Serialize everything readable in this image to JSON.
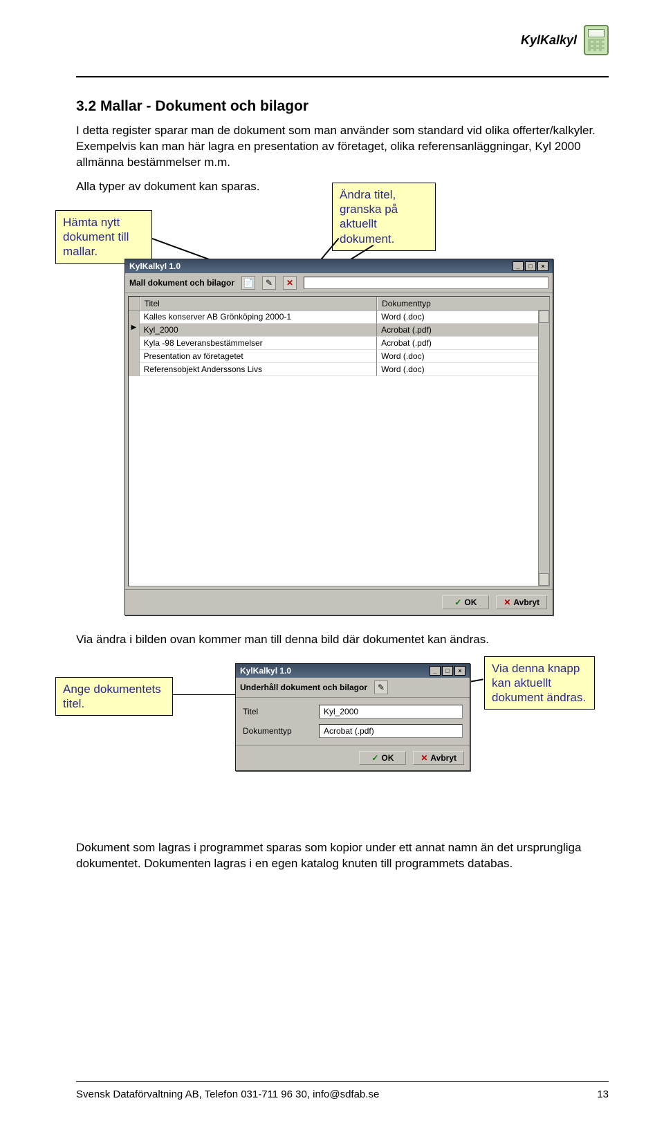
{
  "header": {
    "brand": "KylKalkyl"
  },
  "section_title": "3.2 Mallar - Dokument och bilagor",
  "para1": "I detta register sparar man de dokument som man använder som standard vid olika offerter/kalkyler. Exempelvis kan man här lagra en presentation av företaget, olika referensanläggningar, Kyl 2000 allmänna bestämmelser m.m.",
  "para2": "Alla typer av dokument kan sparas.",
  "callouts": {
    "hamta": "Hämta nytt dokument till mallar.",
    "andra": "Ändra titel, granska på aktuellt dokument.",
    "ange": "Ange dokumentets titel.",
    "via": "Via denna knapp kan aktuellt dokument ändras."
  },
  "dialog1": {
    "title": "KylKalkyl 1.0",
    "toolbar_label": "Mall dokument och bilagor",
    "col_a": "Titel",
    "col_b": "Dokumenttyp",
    "rows": [
      {
        "t": "Kalles konserver AB Grönköping 2000-1",
        "d": "Word (.doc)"
      },
      {
        "t": "Kyl_2000",
        "d": "Acrobat (.pdf)"
      },
      {
        "t": "Kyla -98 Leveransbestämmelser",
        "d": "Acrobat (.pdf)"
      },
      {
        "t": "Presentation av företagetet",
        "d": "Word (.doc)"
      },
      {
        "t": "Referensobjekt Anderssons Livs",
        "d": "Word (.doc)"
      }
    ],
    "ok": "OK",
    "cancel": "Avbryt"
  },
  "para3": "Via ändra i bilden ovan kommer man till denna bild där dokumentet kan ändras.",
  "dialog2": {
    "title": "KylKalkyl 1.0",
    "toolbar_label": "Underhåll dokument och bilagor",
    "label_titel": "Titel",
    "label_typ": "Dokumenttyp",
    "value_titel": "Kyl_2000",
    "value_typ": "Acrobat (.pdf)",
    "ok": "OK",
    "cancel": "Avbryt"
  },
  "para4": "Dokument som lagras i programmet sparas som kopior under ett annat namn än det ursprungliga dokumentet. Dokumenten lagras i en egen katalog knuten till programmets databas.",
  "footer": {
    "left": "Svensk Dataförvaltning AB, Telefon 031-711 96 30, info@sdfab.se",
    "right": "13"
  }
}
